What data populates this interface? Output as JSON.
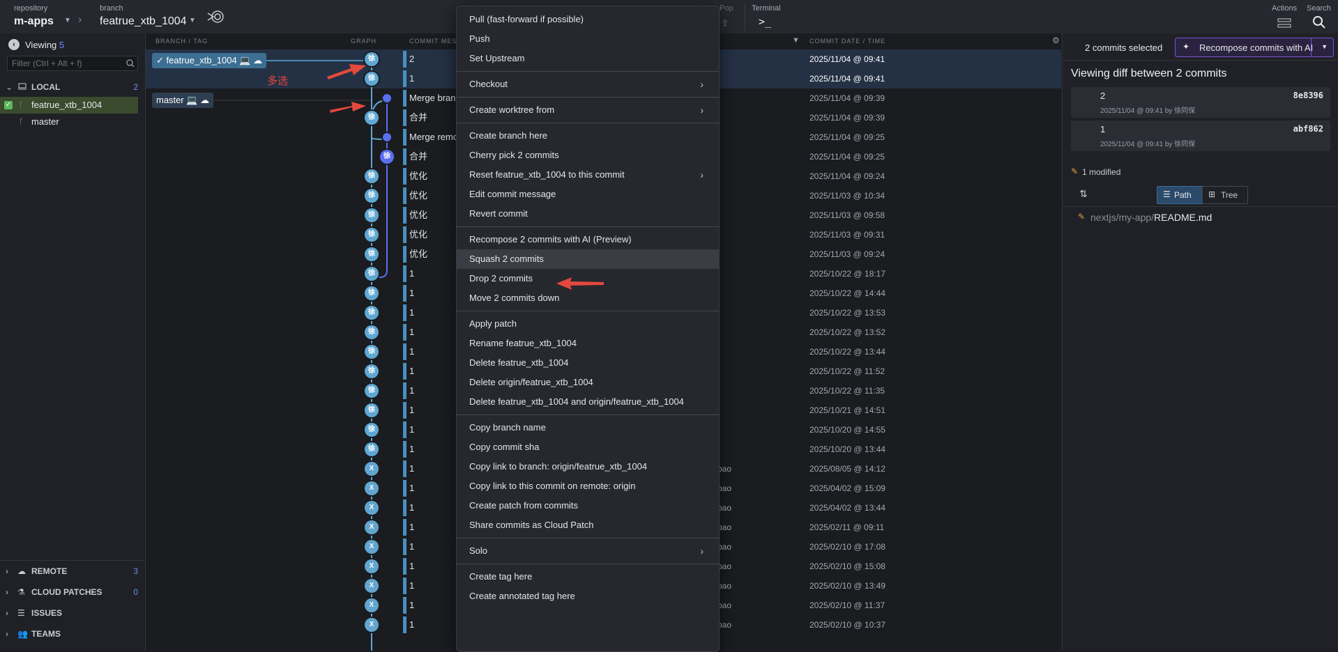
{
  "toolbar": {
    "repo_label": "repository",
    "repo_name": "m-apps",
    "branch_label": "branch",
    "branch_name": "featrue_xtb_1004",
    "pop_label": "Pop",
    "terminal_label": "Terminal",
    "actions_label": "Actions",
    "search_label": "Search"
  },
  "sidebar": {
    "viewing_label": "Viewing",
    "viewing_count": "5",
    "filter_placeholder": "Filter (Ctrl + Alt + f)",
    "local_label": "LOCAL",
    "local_count": "2",
    "branches": [
      "featrue_xtb_1004",
      "master"
    ],
    "remote_label": "REMOTE",
    "remote_count": "3",
    "cloud_label": "CLOUD PATCHES",
    "cloud_count": "0",
    "issues_label": "ISSUES",
    "teams_label": "TEAMS"
  },
  "graph": {
    "col_branch": "BRANCH / TAG",
    "col_graph": "GRAPH",
    "col_message": "COMMIT MESSA",
    "col_date": "COMMIT DATE / TIME",
    "ref_current": "featrue_xtb_1004",
    "ref_master": "master",
    "annotation": "多选",
    "rows": [
      {
        "msg": "2",
        "date": "2025/11/04 @ 09:41",
        "node": "徐",
        "author": ""
      },
      {
        "msg": "1",
        "date": "2025/11/04 @ 09:41",
        "node": "徐",
        "author": ""
      },
      {
        "msg": "Merge bran",
        "date": "2025/11/04 @ 09:39",
        "node": "",
        "author": ""
      },
      {
        "msg": "合并",
        "date": "2025/11/04 @ 09:39",
        "node": "徐",
        "author": ""
      },
      {
        "msg": "Merge remo",
        "date": "2025/11/04 @ 09:25",
        "node": "",
        "author": ""
      },
      {
        "msg": "合并",
        "date": "2025/11/04 @ 09:25",
        "node": "徐",
        "author": ""
      },
      {
        "msg": "优化",
        "date": "2025/11/04 @ 09:24",
        "node": "徐",
        "author": ""
      },
      {
        "msg": "优化",
        "date": "2025/11/03 @ 10:34",
        "node": "徐",
        "author": ""
      },
      {
        "msg": "优化",
        "date": "2025/11/03 @ 09:58",
        "node": "徐",
        "author": ""
      },
      {
        "msg": "优化",
        "date": "2025/11/03 @ 09:31",
        "node": "徐",
        "author": ""
      },
      {
        "msg": "优化",
        "date": "2025/11/03 @ 09:24",
        "node": "徐",
        "author": ""
      },
      {
        "msg": "1",
        "date": "2025/10/22 @ 18:17",
        "node": "徐",
        "author": ""
      },
      {
        "msg": "1",
        "date": "2025/10/22 @ 14:44",
        "node": "徐",
        "author": ""
      },
      {
        "msg": "1",
        "date": "2025/10/22 @ 13:53",
        "node": "徐",
        "author": ""
      },
      {
        "msg": "1",
        "date": "2025/10/22 @ 13:52",
        "node": "徐",
        "author": ""
      },
      {
        "msg": "1",
        "date": "2025/10/22 @ 13:44",
        "node": "徐",
        "author": ""
      },
      {
        "msg": "1",
        "date": "2025/10/22 @ 11:52",
        "node": "徐",
        "author": ""
      },
      {
        "msg": "1",
        "date": "2025/10/22 @ 11:35",
        "node": "徐",
        "author": ""
      },
      {
        "msg": "1",
        "date": "2025/10/21 @ 14:51",
        "node": "徐",
        "author": ""
      },
      {
        "msg": "1",
        "date": "2025/10/20 @ 14:55",
        "node": "徐",
        "author": ""
      },
      {
        "msg": "1",
        "date": "2025/10/20 @ 13:44",
        "node": "徐",
        "author": ""
      },
      {
        "msg": "1",
        "date": "2025/08/05 @ 14:12",
        "node": "X",
        "author": "bao"
      },
      {
        "msg": "1",
        "date": "2025/04/02 @ 15:09",
        "node": "X",
        "author": "bao"
      },
      {
        "msg": "1",
        "date": "2025/04/02 @ 13:44",
        "node": "X",
        "author": "bao"
      },
      {
        "msg": "1",
        "date": "2025/02/11 @ 09:11",
        "node": "X",
        "author": "bao"
      },
      {
        "msg": "1",
        "date": "2025/02/10 @ 17:08",
        "node": "X",
        "author": "bao"
      },
      {
        "msg": "1",
        "date": "2025/02/10 @ 15:08",
        "node": "X",
        "author": "bao"
      },
      {
        "msg": "1",
        "date": "2025/02/10 @ 13:49",
        "node": "X",
        "author": "bao"
      },
      {
        "msg": "1",
        "date": "2025/02/10 @ 11:37",
        "node": "X",
        "author": "bao"
      },
      {
        "msg": "1",
        "date": "2025/02/10 @ 10:37",
        "node": "X",
        "author": "bao"
      }
    ]
  },
  "right": {
    "selected_label": "2 commits selected",
    "recompose_label": "Recompose commits with AI",
    "viewing_diff": "Viewing diff between 2 commits",
    "commits": [
      {
        "msg": "2",
        "sha": "8e8396",
        "meta": "2025/11/04 @ 09:41 by 徐同保"
      },
      {
        "msg": "1",
        "sha": "abf862",
        "meta": "2025/11/04 @ 09:41 by 徐同保"
      }
    ],
    "modified_label": "1 modified",
    "path_tab": "Path",
    "tree_tab": "Tree",
    "file_dir": "nextjs/my-app/",
    "file_name": "README.md"
  },
  "menu": {
    "items": [
      {
        "label": "Pull (fast-forward if possible)",
        "sub": false
      },
      {
        "label": "Push",
        "sub": false
      },
      {
        "label": "Set Upstream",
        "sub": false
      },
      {
        "sep": true
      },
      {
        "label": "Checkout",
        "sub": true
      },
      {
        "sep": true
      },
      {
        "label": "Create worktree from",
        "sub": true
      },
      {
        "sep": true
      },
      {
        "label": "Create branch here",
        "sub": false
      },
      {
        "label": "Cherry pick 2 commits",
        "sub": false
      },
      {
        "label": "Reset featrue_xtb_1004 to this commit",
        "sub": true
      },
      {
        "label": "Edit commit message",
        "sub": false
      },
      {
        "label": "Revert commit",
        "sub": false
      },
      {
        "sep": true
      },
      {
        "label": "Recompose 2 commits with AI (Preview)",
        "sub": false
      },
      {
        "label": "Squash 2 commits",
        "sub": false,
        "hover": true
      },
      {
        "label": "Drop 2 commits",
        "sub": false
      },
      {
        "label": "Move 2 commits down",
        "sub": false
      },
      {
        "sep": true
      },
      {
        "label": "Apply patch",
        "sub": false
      },
      {
        "label": "Rename featrue_xtb_1004",
        "sub": false
      },
      {
        "label": "Delete featrue_xtb_1004",
        "sub": false
      },
      {
        "label": "Delete origin/featrue_xtb_1004",
        "sub": false
      },
      {
        "label": "Delete featrue_xtb_1004 and origin/featrue_xtb_1004",
        "sub": false
      },
      {
        "sep": true
      },
      {
        "label": "Copy branch name",
        "sub": false
      },
      {
        "label": "Copy commit sha",
        "sub": false
      },
      {
        "label": "Copy link to branch: origin/featrue_xtb_1004",
        "sub": false
      },
      {
        "label": "Copy link to this commit on remote: origin",
        "sub": false
      },
      {
        "label": "Create patch from commits",
        "sub": false
      },
      {
        "label": "Share commits as Cloud Patch",
        "sub": false
      },
      {
        "sep": true
      },
      {
        "label": "Solo",
        "sub": true
      },
      {
        "sep": true
      },
      {
        "label": "Create tag here",
        "sub": false
      },
      {
        "label": "Create annotated tag here",
        "sub": false
      }
    ]
  }
}
